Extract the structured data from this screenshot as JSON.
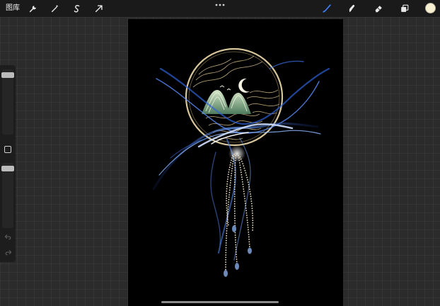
{
  "topbar": {
    "gallery_label": "图库",
    "left_tools": [
      "wrench-icon",
      "magic-wand-icon",
      "selection-s-icon",
      "transform-arrow-icon"
    ],
    "more_icon": "ellipsis-icon",
    "right_tools": [
      "brush-icon",
      "smudge-icon",
      "eraser-icon",
      "layers-icon"
    ],
    "active_tool": "brush-icon",
    "accent_color": "#3f7df0",
    "current_color": "#f7efd2"
  },
  "sidebar": {
    "brush_size": 0.95,
    "brush_opacity": 0.95,
    "modify_icon": "square-icon",
    "undo_icon": "undo-arrow-icon",
    "redo_icon": "redo-arrow-icon"
  },
  "canvas": {
    "background": "#000000",
    "artwork": "gold-ring-landscape-blue-ribbon-tassels"
  }
}
